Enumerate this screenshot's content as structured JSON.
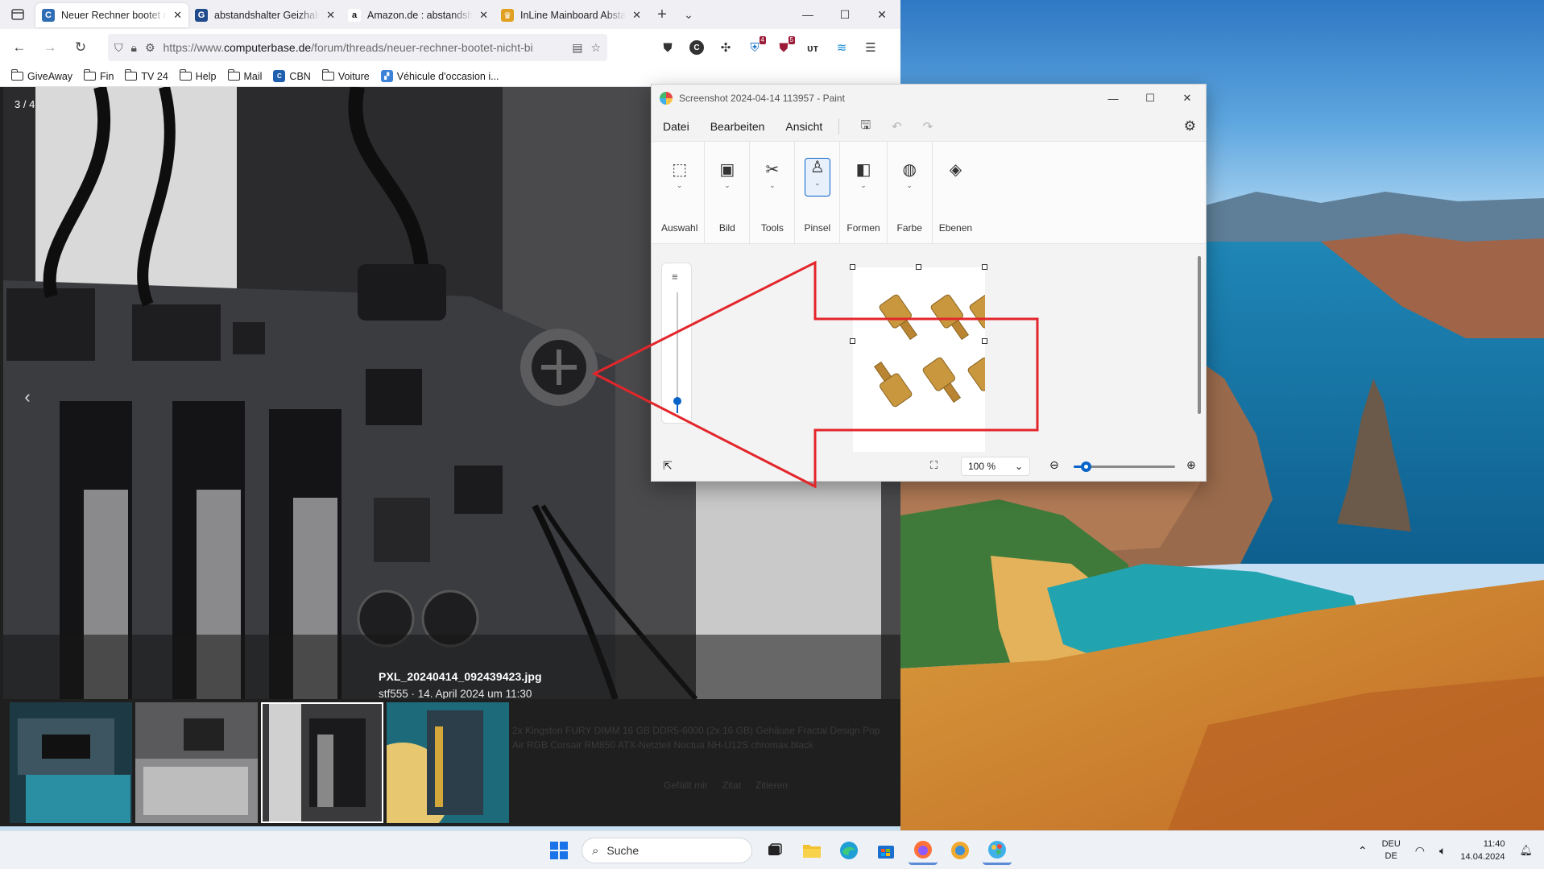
{
  "browser": {
    "tabs": [
      {
        "title": "Neuer Rechner bootet nicht",
        "favicon_color": "#2f6db5",
        "favicon_glyph": "C",
        "active": true
      },
      {
        "title": "abstandshalter Geizhals Deutschland",
        "favicon_color": "#1f4a8c",
        "favicon_glyph": "G",
        "active": false
      },
      {
        "title": "Amazon.de : abstandshalter",
        "favicon_color": "#ffffff",
        "favicon_glyph": "a",
        "active": false
      },
      {
        "title": "InLine Mainboard Abstandshalter",
        "favicon_color": "#e0a020",
        "favicon_glyph": "♛",
        "active": false
      }
    ],
    "tab_close_glyph": "✕",
    "new_tab_glyph": "+",
    "list_tabs_glyph": "⌄",
    "window_controls": {
      "minimize": "—",
      "maximize": "☐",
      "close": "✕"
    },
    "url_prefix": "https://www.",
    "url_domain": "computerbase.de",
    "url_path": "/forum/threads/neuer-rechner-bootet-nicht-bi",
    "extension_badges": {
      "bitwarden": "4",
      "ublock": "5"
    },
    "bookmarks": [
      {
        "label": "GiveAway",
        "icon": "folder-icon"
      },
      {
        "label": "Fin",
        "icon": "folder-icon"
      },
      {
        "label": "TV 24",
        "icon": "folder-icon"
      },
      {
        "label": "Help",
        "icon": "folder-icon"
      },
      {
        "label": "Mail",
        "icon": "folder-icon"
      },
      {
        "label": "CBN",
        "icon": "cbn-favicon"
      },
      {
        "label": "Voiture",
        "icon": "folder-icon"
      },
      {
        "label": "Véhicule d'occasion i...",
        "icon": "vehicle-favicon"
      }
    ]
  },
  "lightbox": {
    "counter": "3 / 4",
    "filename": "PXL_20240414_092439423.jpg",
    "meta": "stf555 · 14. April 2024 um 11:30",
    "prev_glyph": "‹",
    "ghost_text": "2x Kingston FURY DIMM 16 GB DDR5-6000 (2x 16 GB) Gehäuse Fractal Design Pop Air RGB Corsair RM850 ATX-Netzteil Noctua NH-U12S chromax.black",
    "ghost_actions": [
      "Gefällt mir",
      "Zitat",
      "Zitieren"
    ]
  },
  "paint": {
    "title": "Screenshot 2024-04-14 113957 - Paint",
    "menu": [
      "Datei",
      "Bearbeiten",
      "Ansicht"
    ],
    "ribbon": [
      {
        "label": "Auswahl",
        "icon": "selection-icon",
        "glyph": "⬚",
        "selected": false
      },
      {
        "label": "Bild",
        "icon": "image-icon",
        "glyph": "▣",
        "selected": false
      },
      {
        "label": "Tools",
        "icon": "tools-icon",
        "glyph": "✂",
        "selected": false
      },
      {
        "label": "Pinsel",
        "icon": "brush-icon",
        "glyph": "♙",
        "selected": true
      },
      {
        "label": "Formen",
        "icon": "shapes-icon",
        "glyph": "◧",
        "selected": false
      },
      {
        "label": "Farbe",
        "icon": "palette-icon",
        "glyph": "◍",
        "selected": false
      },
      {
        "label": "Ebenen",
        "icon": "layers-icon",
        "glyph": "◈",
        "selected": false
      }
    ],
    "zoom_value": "100 %",
    "zoom_level_fraction": 0.12,
    "brush_size_fraction": 0.1,
    "accent_color": "#0a64c8"
  },
  "annotation": {
    "arrow_color": "#e3262b"
  },
  "taskbar": {
    "search_label": "Suche",
    "lang_top": "DEU",
    "lang_bottom": "DE",
    "time": "11:40",
    "date": "14.04.2024"
  }
}
